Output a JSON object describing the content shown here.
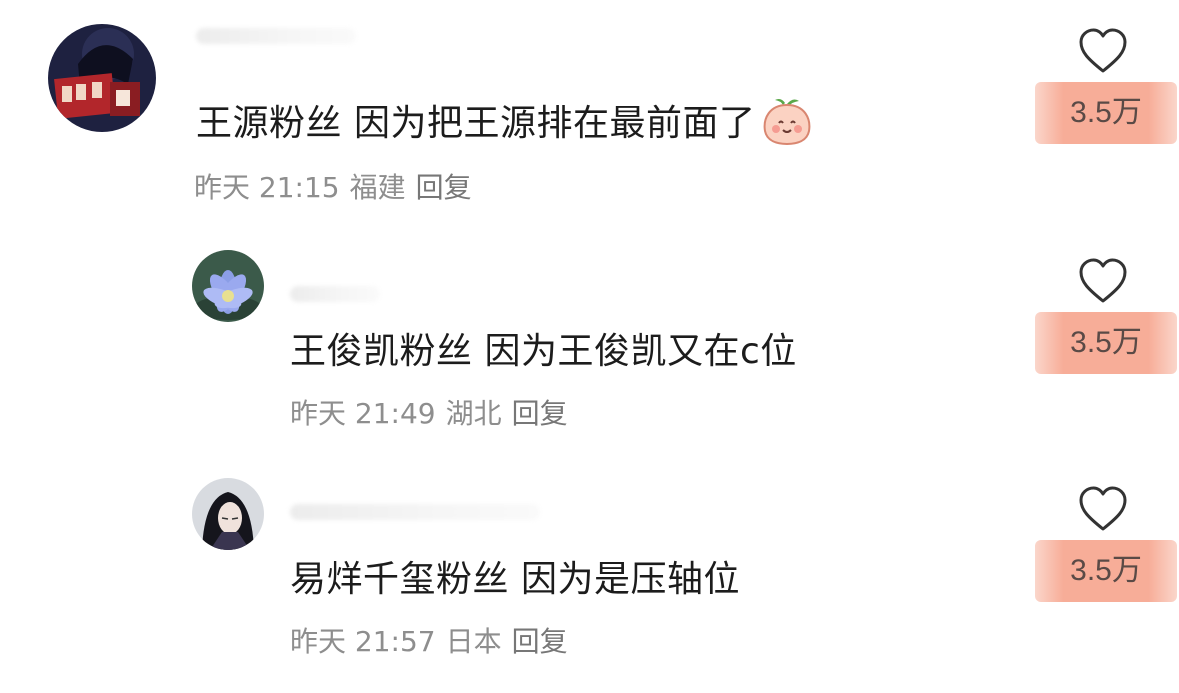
{
  "comments": [
    {
      "text": "王源粉丝 因为把王源排在最前面了",
      "time": "昨天 21:15",
      "location": "福建",
      "reply_label": "回复",
      "likes": "3.5万"
    },
    {
      "text": "王俊凯粉丝 因为王俊凯又在c位",
      "time": "昨天 21:49",
      "location": "湖北",
      "reply_label": "回复",
      "likes": "3.5万"
    },
    {
      "text": "易烊千玺粉丝 因为是压轴位",
      "time": "昨天 21:57",
      "location": "日本",
      "reply_label": "回复",
      "likes": "3.5万"
    }
  ],
  "icons": {
    "like": "heart-outline-icon",
    "emoji": "smiling-peach-emoji"
  },
  "colors": {
    "highlight": "#f7ad98",
    "meta_text": "#8e8e8e",
    "icon": "#333333"
  }
}
